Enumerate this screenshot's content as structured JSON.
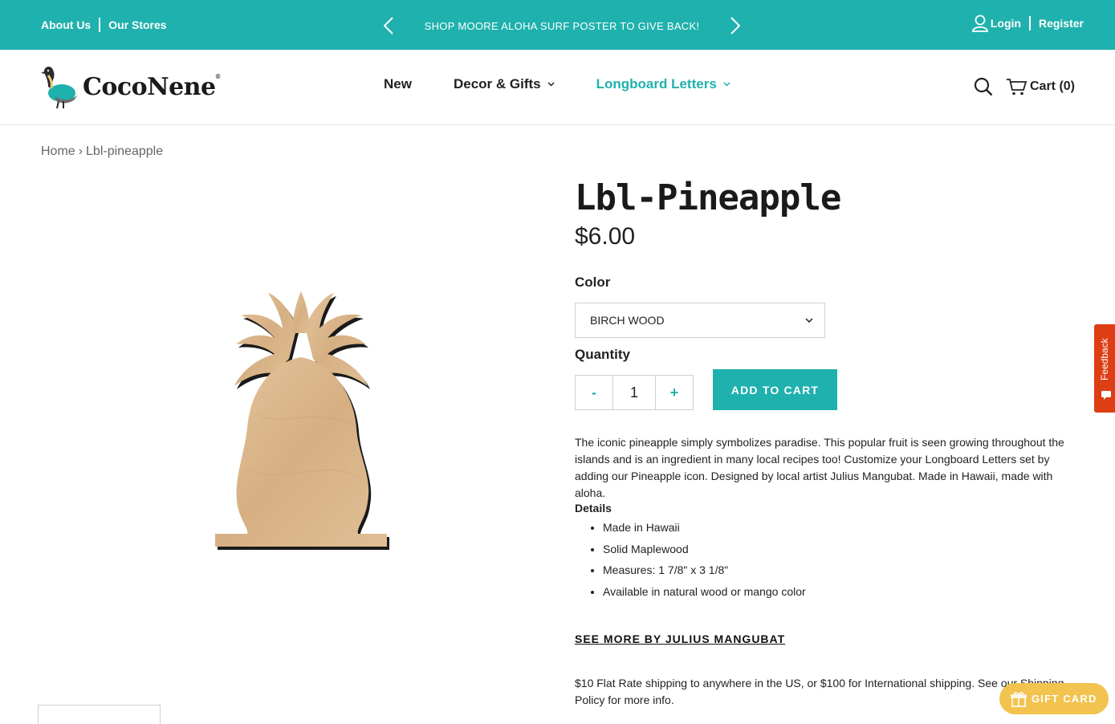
{
  "topbar": {
    "about_label": "About Us",
    "stores_label": "Our Stores",
    "promo_text": "SHOP MOORE ALOHA SURF POSTER TO GIVE BACK!",
    "login_label": "Login",
    "register_label": "Register"
  },
  "header": {
    "logo_text": "CocoNene",
    "logo_mark": "®",
    "nav": [
      {
        "label": "New"
      },
      {
        "label": "Decor & Gifts"
      },
      {
        "label": "Longboard Letters"
      }
    ],
    "cart_label": "Cart (0)"
  },
  "breadcrumb": {
    "home": "Home",
    "separator": "›",
    "current": "Lbl-pineapple"
  },
  "product": {
    "title": "Lbl-Pineapple",
    "price": "$6.00",
    "color_label": "Color",
    "color_value": "BIRCH WOOD",
    "quantity_label": "Quantity",
    "quantity_value": "1",
    "minus_label": "-",
    "plus_label": "+",
    "add_to_cart_label": "ADD TO CART",
    "description": "The iconic pineapple simply symbolizes paradise. This popular fruit is seen growing throughout the islands and is an ingredient in many local recipes too! Customize your Longboard Letters set by adding our Pineapple icon. Designed by local artist Julius Mangubat. Made in Hawaii, made with aloha.",
    "details_title": "Details",
    "details": [
      "Made in Hawaii",
      "Solid Maplewood",
      "Measures: 1 7/8\" x 3 1/8\"",
      "Available in natural wood or mango color"
    ],
    "see_more_label": "SEE MORE BY JULIUS MANGUBAT",
    "shipping_text": "$10 Flat Rate shipping to anywhere in the US, or $100 for International shipping. See our Shipping Policy for more info."
  },
  "floating": {
    "feedback_label": "Feedback",
    "gift_card_label": "GIFT CARD"
  },
  "colors": {
    "accent": "#1fb1ad",
    "feedback": "#dd3e13",
    "gift_card": "#f2c34e",
    "wood": "#dcb88e"
  }
}
